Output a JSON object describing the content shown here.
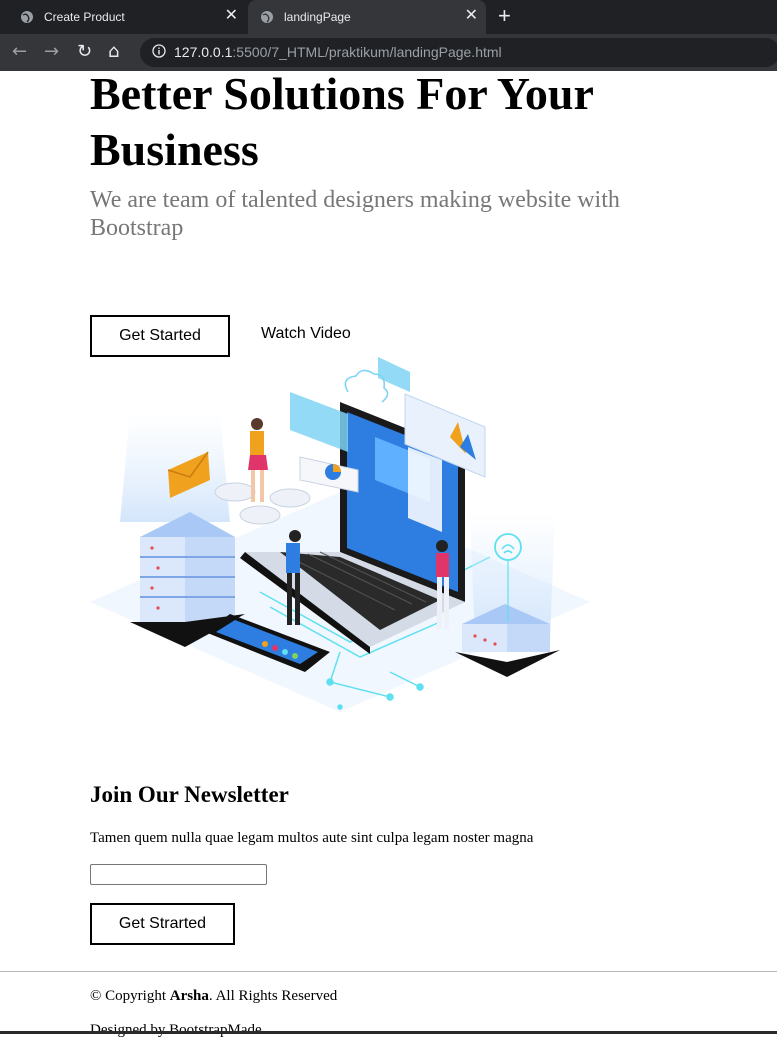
{
  "browser": {
    "tabs": [
      {
        "title": "Create Product",
        "icon": "globe-icon",
        "close": "✕"
      },
      {
        "title": "landingPage",
        "icon": "globe-icon",
        "close": "✕"
      }
    ],
    "new_tab": "+",
    "nav": {
      "back": "←",
      "forward": "→",
      "reload": "↻",
      "home": "⌂"
    },
    "url_host": "127.0.0.1",
    "url_rest": ":5500/7_HTML/praktikum/landingPage.html"
  },
  "hero": {
    "title": "Better Solutions For Your Business",
    "subtitle": "We are team of talented designers making website with Bootstrap",
    "get_started": "Get Started",
    "watch_video": "Watch Video"
  },
  "newsletter": {
    "title": "Join Our Newsletter",
    "text": "Tamen quem nulla quae legam multos aute sint culpa legam noster magna",
    "input_value": "",
    "button": "Get Strarted"
  },
  "footer": {
    "copyright_prefix": "© Copyright ",
    "brand": "Arsha",
    "copyright_suffix": ". All Rights Reserved",
    "designed_by": "Designed by BootstrapMade"
  }
}
